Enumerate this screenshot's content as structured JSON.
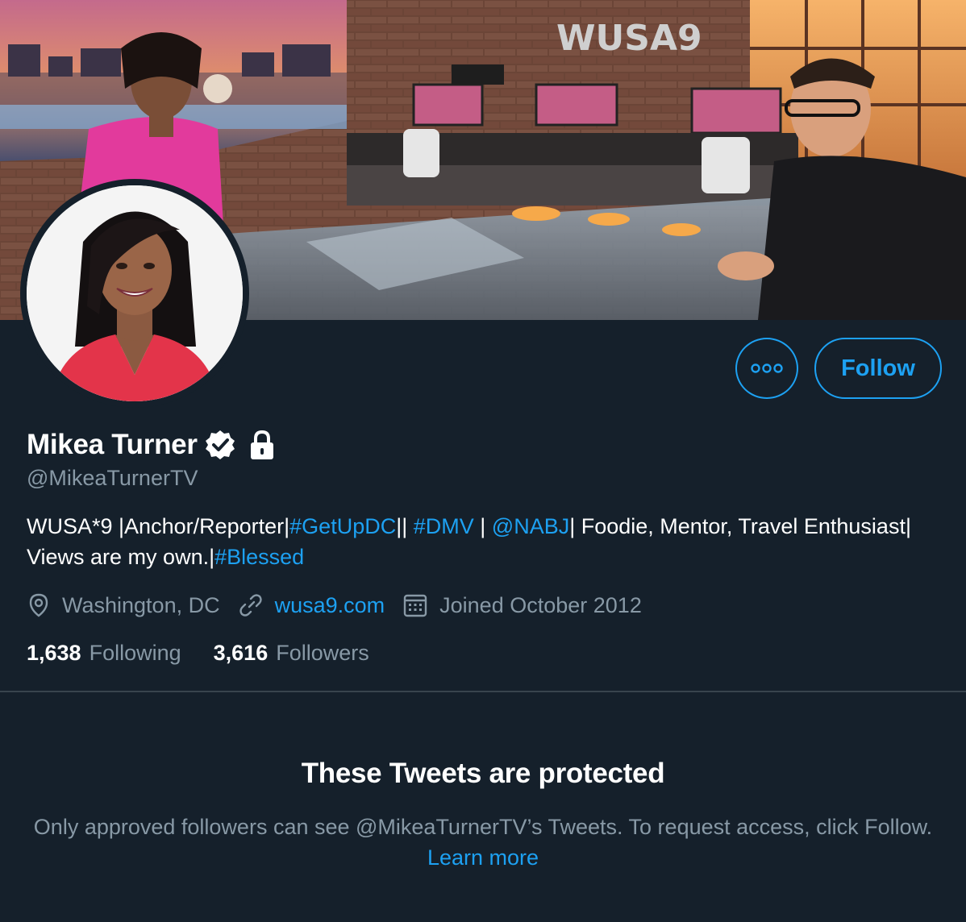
{
  "banner": {
    "studio_logo": "WUSA9",
    "monitor_label": "WUSA9"
  },
  "profile": {
    "display_name": "Mikea Turner",
    "handle": "@MikeaTurnerTV",
    "verified": true,
    "protected": true,
    "bio": {
      "part1": "WUSA*9 |Anchor/Reporter|",
      "tag_getupdc": "#GetUpDC",
      "part2": "|| ",
      "tag_dmv": "#DMV",
      "part3": " | ",
      "mention_nabj": "@NABJ",
      "part4": "| Foodie, Mentor, Travel Enthusiast| Views are my own.|",
      "tag_blessed": "#Blessed"
    },
    "location": "Washington, DC",
    "website": "wusa9.com",
    "joined": "Joined October 2012",
    "following_count": "1,638",
    "following_label": "Following",
    "followers_count": "3,616",
    "followers_label": "Followers"
  },
  "actions": {
    "follow_label": "Follow",
    "more_icon": "more-horizontal-icon"
  },
  "protected_notice": {
    "title": "These Tweets are protected",
    "text_part1": "Only approved followers can see @MikeaTurnerTV’s Tweets. To request access, click Follow. ",
    "learn_more": "Learn more"
  },
  "colors": {
    "background": "#15202b",
    "accent": "#1da1f2",
    "secondary_text": "#8899a6",
    "divider": "#38444d"
  }
}
